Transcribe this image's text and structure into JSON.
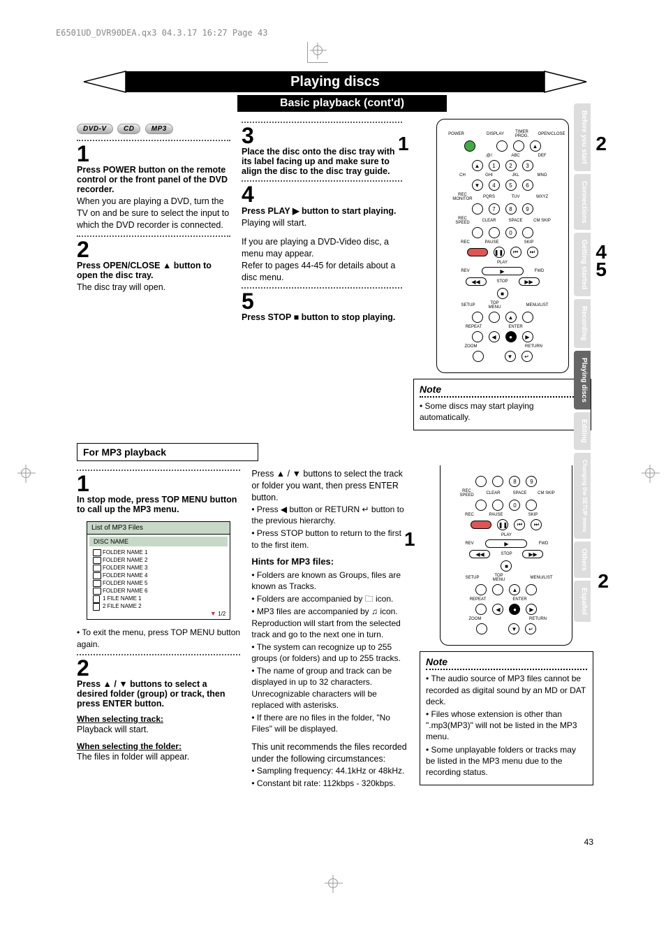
{
  "print_header": "E6501UD_DVR90DEA.qx3  04.3.17  16:27  Page 43",
  "title": "Playing discs",
  "subtitle": "Basic playback (cont'd)",
  "media_pills": [
    "DVD-V",
    "CD",
    "MP3"
  ],
  "steps": {
    "s1": {
      "num": "1",
      "bold": "Press POWER button on the remote control or the front panel of the DVD recorder.",
      "rest": "When you are playing a DVD, turn the TV on and be sure to select the input to which the DVD recorder is connected."
    },
    "s2": {
      "num": "2",
      "bold": "Press OPEN/CLOSE ▲ button to open the disc tray.",
      "rest": "The disc tray will open."
    },
    "s3": {
      "num": "3",
      "bold": "Place the disc onto the disc tray with its label facing up and make sure to align the disc to the disc tray guide."
    },
    "s4": {
      "num": "4",
      "bold": "Press PLAY ▶ button to start playing.",
      "rest": "Playing will start.",
      "extra": "If you are playing a DVD-Video disc, a menu may appear.\nRefer to pages 44-45 for details about a disc menu."
    },
    "s5": {
      "num": "5",
      "bold": "Press STOP ■ button to stop playing."
    }
  },
  "remote1": {
    "labels": [
      "POWER",
      "DISPLAY",
      "TIMER PROG.",
      "OPEN/CLOSE",
      "CH",
      "GHI",
      "JKL",
      "MNO",
      "REC MONITOR",
      "PQRS",
      "TUV",
      "WXYZ",
      "REC SPEED",
      "CLEAR",
      "SPACE",
      "CM SKIP",
      "REC",
      "PAUSE",
      "SKIP",
      "PLAY",
      "REV",
      "FWD",
      "STOP",
      "SETUP",
      "TOP MENU",
      "MENU/LIST",
      "REPEAT",
      "ENTER",
      "ZOOM",
      "RETURN",
      ".@/:",
      "ABC",
      "DEF"
    ],
    "nums": [
      "1",
      "2",
      "3",
      "4",
      "5",
      "6",
      "7",
      "8",
      "9",
      "0"
    ],
    "callouts": {
      "c1": "1",
      "c2": "2",
      "c4": "4",
      "c5": "5"
    }
  },
  "note1": {
    "title": "Note",
    "items": [
      "Some discs may start playing automatically."
    ]
  },
  "mp3header": "For MP3 playback",
  "mp3": {
    "s1": {
      "num": "1",
      "bold": "In stop mode, press TOP MENU button to call up the MP3 menu."
    },
    "osd": {
      "title": "List of MP3 Files",
      "disc": "DISC NAME",
      "items": [
        "FOLDER NAME 1",
        "FOLDER NAME 2",
        "FOLDER NAME 3",
        "FOLDER NAME 4",
        "FOLDER NAME 5",
        "FOLDER NAME 6",
        "1   FILE NAME 1",
        "2   FILE NAME 2"
      ],
      "page": "1/2"
    },
    "s1note": "To exit the menu, press TOP MENU button again.",
    "s2": {
      "num": "2",
      "bold": "Press ▲ / ▼ buttons to select a desired folder (group) or track, then press ENTER button."
    },
    "sel_track_h": "When selecting track:",
    "sel_track_t": "Playback will start.",
    "sel_folder_h": "When selecting the folder:",
    "sel_folder_t": "The files in folder will appear.",
    "col2_top": "Press ▲ / ▼ buttons to select the track or folder you want, then press ENTER button.",
    "col2_b1": "Press ◀ button or RETURN ↵ button to the previous hierarchy.",
    "col2_b2": "Press STOP button to return to the first to the first item.",
    "hints_h": "Hints for MP3 files:",
    "hints": [
      "Folders are known as Groups, files are known as Tracks.",
      "Folders are accompanied by 🗀 icon.",
      "MP3 files are accompanied by ♫ icon. Reproduction will start from the selected track and go to the next one in turn.",
      "The system can recognize up to 255 groups (or folders) and up to 255 tracks.",
      "The name of group and track can be displayed in up to 32 characters. Unrecognizable characters will be replaced with asterisks.",
      "If there are no files in the folder, \"No Files\" will be displayed."
    ],
    "rec_intro": "This unit recommends the files recorded under the following circumstances:",
    "rec": [
      "Sampling frequency: 44.1kHz or 48kHz.",
      "Constant bit rate: 112kbps - 320kbps."
    ]
  },
  "remote2": {
    "callouts": {
      "c1": "1",
      "c2": "2"
    }
  },
  "note2": {
    "title": "Note",
    "items": [
      "The audio source of MP3 files cannot be recorded as digital sound by an MD or DAT deck.",
      "Files whose extension is other than \".mp3(MP3)\" will not be listed in the MP3 menu.",
      "Some unplayable folders or tracks may be listed in the MP3 menu due to the recording status."
    ]
  },
  "tabs": [
    "Before you start",
    "Connections",
    "Getting started",
    "Recording",
    "Playing discs",
    "Editing",
    "Changing the SETUP menu",
    "Others",
    "Español"
  ],
  "active_tab": "Playing discs",
  "page_number": "43"
}
